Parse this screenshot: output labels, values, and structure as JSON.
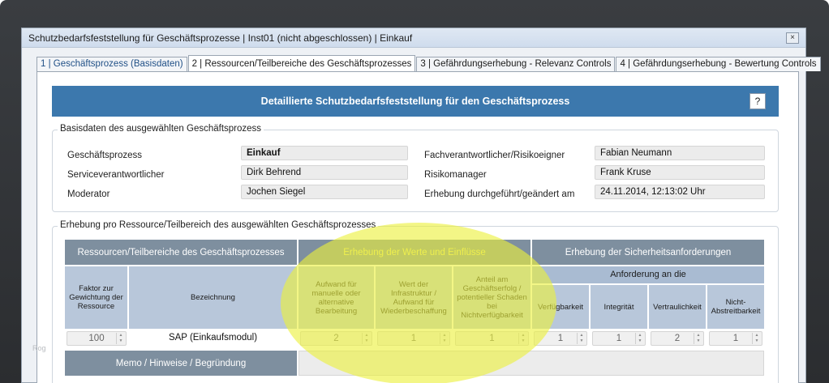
{
  "window": {
    "title": "Schutzbedarfsfeststellung für Geschäftsprozesse | Inst01 (nicht abgeschlossen) | Einkauf",
    "close_label": "×"
  },
  "tabs": [
    {
      "label": "1 | Geschäftsprozess (Basisdaten)"
    },
    {
      "label": "2 | Ressourcen/Teilbereiche des Geschäftsprozesses"
    },
    {
      "label": "3 | Gefährdungserhebung - Relevanz Controls"
    },
    {
      "label": "4 | Gefährdungserhebung - Bewertung Controls"
    }
  ],
  "banner": {
    "title": "Detaillierte Schutzbedarfsfeststellung für den Geschäftsprozess",
    "help_label": "?"
  },
  "basisdaten": {
    "legend": "Basisdaten des ausgewählten Geschäftsprozess",
    "left": [
      {
        "label": "Geschäftsprozess",
        "value": "Einkauf"
      },
      {
        "label": "Serviceverantwortlicher",
        "value": "Dirk Behrend"
      },
      {
        "label": "Moderator",
        "value": "Jochen Siegel"
      }
    ],
    "right": [
      {
        "label": "Fachverantwortlicher/Risikoeigner",
        "value": "Fabian Neumann"
      },
      {
        "label": "Risikomanager",
        "value": "Frank Kruse"
      },
      {
        "label": "Erhebung durchgeführt/geändert am",
        "value": "24.11.2014, 12:13:02 Uhr"
      }
    ]
  },
  "erhebung": {
    "legend": "Erhebung pro Ressource/Teilbereich des ausgewählten Geschäftsprozesses",
    "group_headers": {
      "ressourcen": "Ressourcen/Teilbereiche des Geschäftsprozesses",
      "werte": "Erhebung der Werte und Einflüsse",
      "sicherheit": "Erhebung der Sicherheitsanforderungen",
      "anforderung": "Anforderung an die"
    },
    "columns": {
      "faktor": "Faktor zur Gewichtung der Ressource",
      "bezeichnung": "Bezeichnung",
      "aufwand": "Aufwand für manuelle oder alternative Bearbeitung",
      "wert": "Wert der Infrastruktur / Aufwand für Wiederbeschaffung",
      "anteil": "Anteil am Geschäftserfolg / potentieller Schaden bei Nichtverfügbarkeit",
      "verfuegbarkeit": "Verfügbarkeit",
      "integritaet": "Integrität",
      "vertraulichkeit": "Vertraulichkeit",
      "nicht_abstreitbarkeit": "Nicht-Abstreitbarkeit"
    },
    "row": {
      "faktor": "100",
      "bezeichnung": "SAP (Einkaufsmodul)",
      "aufwand": "2",
      "wert": "1",
      "anteil": "1",
      "verfuegbarkeit": "1",
      "integritaet": "1",
      "vertraulichkeit": "2",
      "nicht_abstreitbarkeit": "1"
    },
    "memo_label": "Memo / Hinweise / Begründung"
  },
  "watermark": "Rog",
  "colors": {
    "banner": "#3c78ad",
    "header_dark": "#7e8f9f",
    "header_light": "#b8c7da",
    "highlight": "#ebf03c"
  }
}
